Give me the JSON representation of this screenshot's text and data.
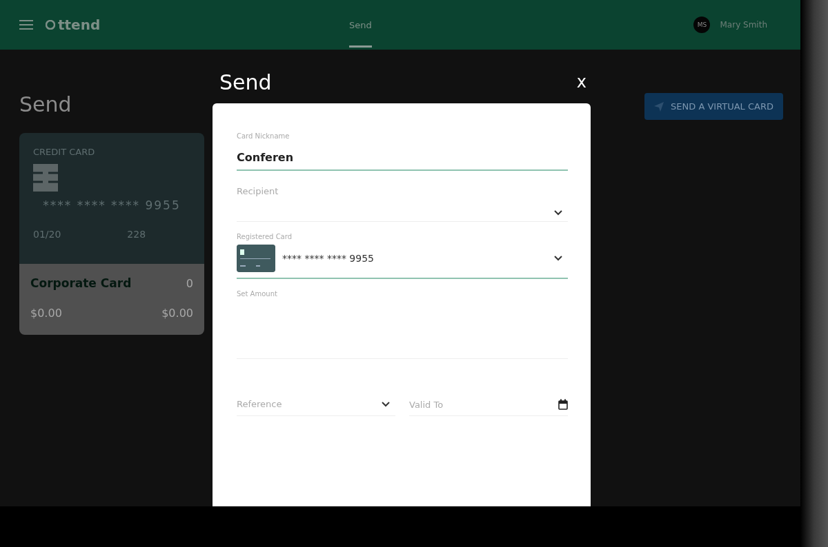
{
  "topbar": {
    "brand": "ttend",
    "nav": [
      {
        "label": "Send",
        "selected": true
      }
    ],
    "user": {
      "initials": "MS",
      "name": "Mary Smith"
    }
  },
  "page": {
    "title": "Send",
    "action": "SEND A VIRTUAL CARD",
    "card": {
      "type_label": "CREDIT CARD",
      "number": "**** **** **** 9955",
      "expiry": "01/20",
      "cvv": "228",
      "name": "Corporate Card",
      "count": "0",
      "amount_left": "$0.00",
      "amount_right": "$0.00"
    }
  },
  "dialog": {
    "title": "Send",
    "close": "x",
    "fields": [
      {
        "kind": "text",
        "label": "Card Nickname",
        "value": "Conferen",
        "focused": true
      },
      {
        "kind": "select",
        "label": "Recipient",
        "focused": false
      },
      {
        "kind": "card-select",
        "label": "Registered Card",
        "value": "**** **** **** 9955",
        "focused": true
      },
      {
        "kind": "amount",
        "label": "Set Amount",
        "focused": false
      },
      {
        "kind": "half-select",
        "label": "Reference",
        "focused": false
      },
      {
        "kind": "date",
        "label": "Valid To",
        "focused": false
      }
    ]
  }
}
